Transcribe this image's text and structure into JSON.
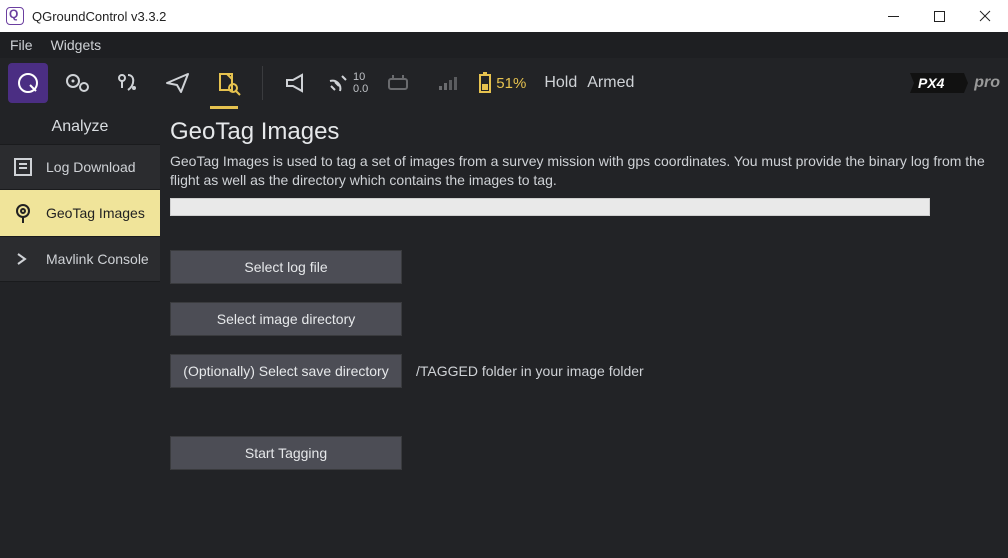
{
  "window": {
    "title": "QGroundControl v3.3.2"
  },
  "menubar": {
    "file": "File",
    "widgets": "Widgets"
  },
  "toolbar": {
    "speed_top": "10",
    "speed_bot": "0.0",
    "battery_pct": "51%",
    "mode": "Hold",
    "armed": "Armed",
    "brand": "PX4",
    "brand_suffix": "pro"
  },
  "sidebar": {
    "title": "Analyze",
    "items": [
      {
        "label": "Log Download"
      },
      {
        "label": "GeoTag Images"
      },
      {
        "label": "Mavlink Console"
      }
    ]
  },
  "main": {
    "heading": "GeoTag Images",
    "description": "GeoTag Images is used to tag a set of images from a survey mission with gps coordinates. You must provide the binary log from the flight as well as the directory which contains the images to tag.",
    "buttons": {
      "select_log": "Select log file",
      "select_image_dir": "Select image directory",
      "select_save_dir": "(Optionally) Select save directory",
      "save_dir_hint": "/TAGGED folder in your image folder",
      "start": "Start Tagging"
    }
  }
}
